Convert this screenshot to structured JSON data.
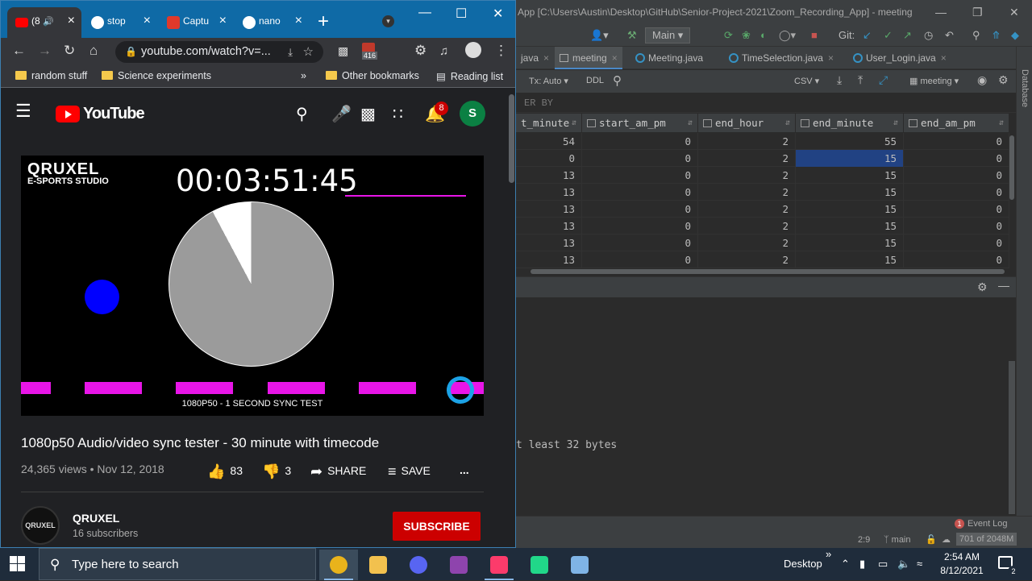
{
  "ide": {
    "title": "App [C:\\Users\\Austin\\Desktop\\GitHub\\Senior-Project-2021\\Zoom_Recording_App] - meeting",
    "branch_dropdown": "Main",
    "git_label": "Git:",
    "tabs": [
      {
        "label": "java",
        "active": false
      },
      {
        "label": "meeting",
        "active": true
      },
      {
        "label": "Meeting.java",
        "active": false
      },
      {
        "label": "TimeSelection.java",
        "active": false
      },
      {
        "label": "User_Login.java",
        "active": false
      }
    ],
    "sidebar_label": "Database",
    "db_toolbar": {
      "tx": "Tx: Auto",
      "ddl": "DDL",
      "format": "CSV",
      "datasource": "meeting"
    },
    "order_by": "ER BY",
    "table": {
      "columns": [
        "t_minute",
        "start_am_pm",
        "end_hour",
        "end_minute",
        "end_am_pm"
      ],
      "rows": [
        [
          "54",
          "0",
          "2",
          "55",
          "0"
        ],
        [
          "0",
          "0",
          "2",
          "15",
          "0"
        ],
        [
          "13",
          "0",
          "2",
          "15",
          "0"
        ],
        [
          "13",
          "0",
          "2",
          "15",
          "0"
        ],
        [
          "13",
          "0",
          "2",
          "15",
          "0"
        ],
        [
          "13",
          "0",
          "2",
          "15",
          "0"
        ],
        [
          "13",
          "0",
          "2",
          "15",
          "0"
        ],
        [
          "13",
          "0",
          "2",
          "15",
          "0"
        ]
      ],
      "selected_row": 1,
      "selected_col": 3
    },
    "console_text": "t least 32 bytes",
    "event_log": {
      "count": "1",
      "label": "Event Log"
    },
    "status": {
      "position": "2:9",
      "branch": "main",
      "memory": "701 of 2048M"
    }
  },
  "chrome": {
    "tabs": [
      {
        "label": "(8",
        "color": "#ff0000",
        "active": true
      },
      {
        "label": "stop",
        "color": "#ffffff",
        "active": false
      },
      {
        "label": "Captu",
        "color": "#e0392b",
        "active": false
      },
      {
        "label": "nano",
        "color": "#ffffff",
        "active": false
      }
    ],
    "url": "youtube.com/watch?v=...",
    "extension_badge": "416",
    "bookmarks": [
      {
        "label": "random stuff",
        "type": "folder"
      },
      {
        "label": "Science experiments",
        "type": "folder"
      },
      {
        "label": "Other bookmarks",
        "type": "folder"
      },
      {
        "label": "Reading list",
        "type": "list"
      }
    ],
    "bookmarks_overflow": "»"
  },
  "youtube": {
    "logo_text": "YouTube",
    "notification_count": "8",
    "avatar_letter": "S",
    "player": {
      "brand_line1": "QRUXEL",
      "brand_line2": "E-SPORTS STUDIO",
      "timecode": "00:03:51:45",
      "caption": "1080P50 - 1 SECOND SYNC TEST"
    },
    "video": {
      "title": "1080p50 Audio/video sync tester - 30 minute with timecode",
      "meta": "24,365 views • Nov 12, 2018",
      "likes": "83",
      "dislikes": "3",
      "share": "SHARE",
      "save": "SAVE",
      "more": "..."
    },
    "channel": {
      "avatar_text": "QRUXEL",
      "name": "QRUXEL",
      "subscribers": "16 subscribers",
      "subscribe_label": "SUBSCRIBE"
    }
  },
  "taskbar": {
    "search_placeholder": "Type here to search",
    "desktop_label": "Desktop",
    "time": "2:54 AM",
    "date": "8/12/2021",
    "notification_badge": "2",
    "apps": [
      {
        "name": "chrome",
        "color": "#e9b31b",
        "active": true
      },
      {
        "name": "file-explorer",
        "color": "#f2c14e",
        "active": false
      },
      {
        "name": "discord",
        "color": "#5865f2",
        "active": false
      },
      {
        "name": "app-cube",
        "color": "#8e44ad",
        "active": false
      },
      {
        "name": "intellij",
        "color": "#fc3b6b",
        "active": true
      },
      {
        "name": "pycharm",
        "color": "#21d789",
        "active": false
      },
      {
        "name": "notepad",
        "color": "#7fb4e6",
        "active": false
      }
    ]
  }
}
